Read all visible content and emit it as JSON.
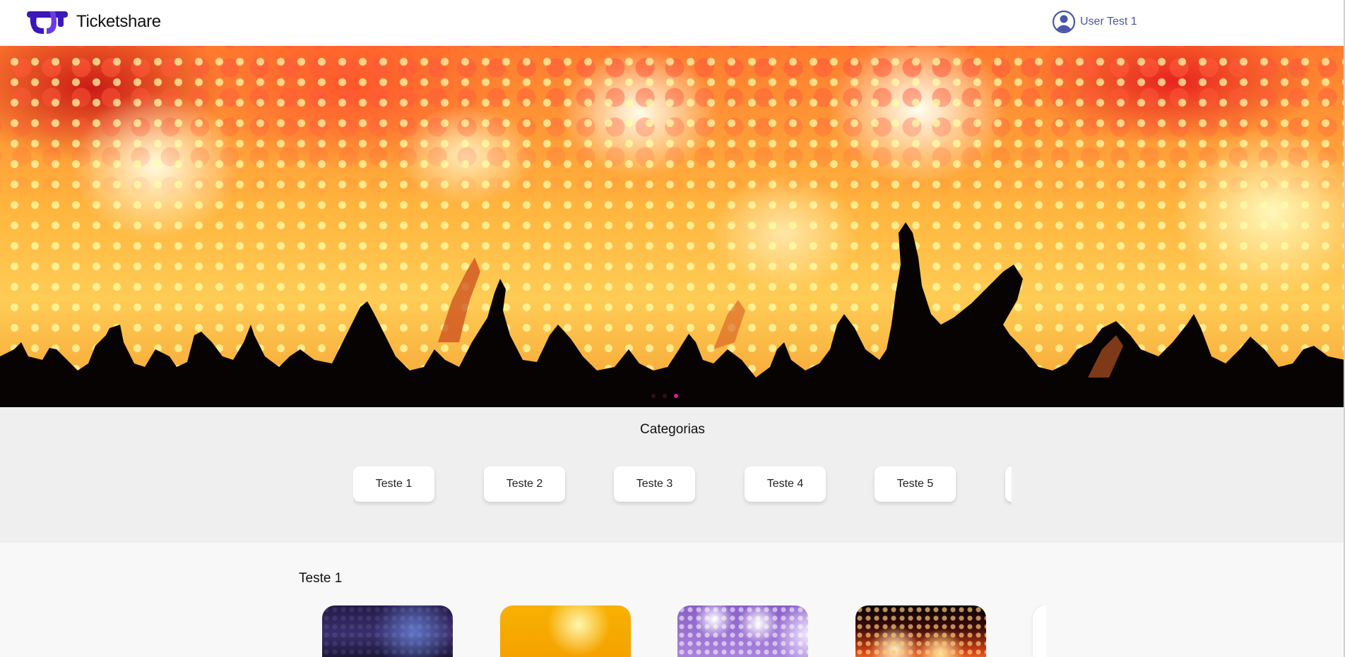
{
  "header": {
    "brand": "Ticketshare",
    "user_name": "User Test 1"
  },
  "hero": {
    "slide_count": 3,
    "active_slide": 3
  },
  "categories": {
    "title": "Categorias",
    "items": [
      "Teste 1",
      "Teste 2",
      "Teste 3",
      "Teste 4",
      "Teste 5",
      ""
    ]
  },
  "section": {
    "title": "Teste 1"
  },
  "colors": {
    "brand_purple": "#5b2dd8",
    "user_link": "#4b56a8",
    "indicator_active": "#d61a9a",
    "categories_bg": "#efefef"
  }
}
